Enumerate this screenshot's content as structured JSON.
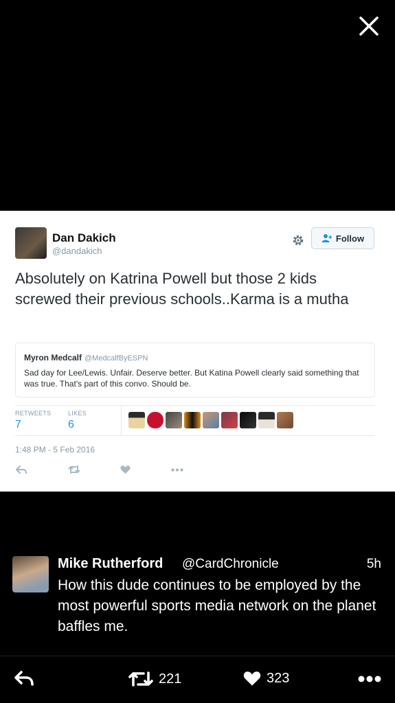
{
  "tweet": {
    "author_name": "Dan Dakich",
    "author_handle": "@dandakich",
    "follow_label": "Follow",
    "text": "Absolutely on Katrina Powell but those 2 kids screwed their previous schools..Karma is a mutha",
    "quote": {
      "name": "Myron Medcalf",
      "handle": "@MedcalfByESPN",
      "text": "Sad day for Lee/Lewis. Unfair. Deserve better. But Katina Powell clearly said something that was true. That's part of this convo. Should be."
    },
    "retweets_label": "RETWEETS",
    "retweets_count": "7",
    "likes_label": "LIKES",
    "likes_count": "6",
    "timestamp": "1:48 PM - 5 Feb 2016"
  },
  "reply": {
    "name": "Mike Rutherford",
    "handle": "@CardChronicle",
    "time": "5h",
    "text": "How this dude continues to be employed by the most powerful sports media network on the planet baffles me."
  },
  "bottom_bar": {
    "retweet_count": "221",
    "like_count": "323"
  },
  "colors": {
    "accent": "#1b95e0",
    "muted": "#8899a6",
    "background": "#000000"
  }
}
